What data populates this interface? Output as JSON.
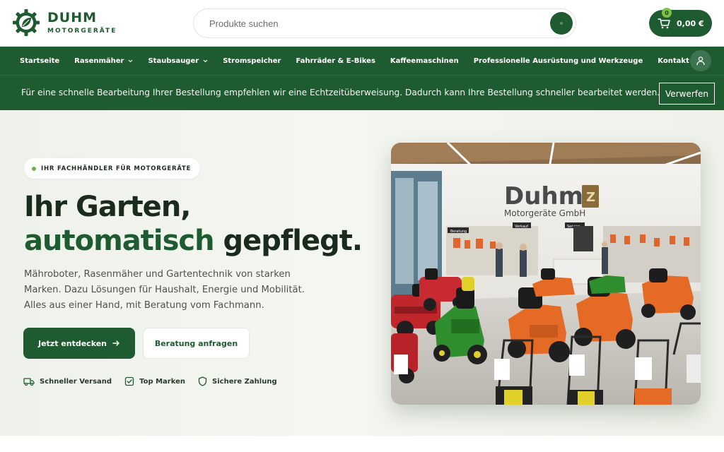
{
  "brand": {
    "name": "DUHM",
    "tagline": "MOTORGERÄTE",
    "logo_icon": "gear-leaf-icon",
    "color_primary": "#1f5b30",
    "color_accent": "#6db144"
  },
  "search": {
    "placeholder": "Produkte suchen",
    "icon": "search-icon"
  },
  "cart": {
    "count": "0",
    "total": "0,00 €",
    "icon": "cart-icon"
  },
  "nav": {
    "items": [
      {
        "label": "Startseite",
        "dropdown": false
      },
      {
        "label": "Rasenmäher",
        "dropdown": true
      },
      {
        "label": "Staubsauger",
        "dropdown": true
      },
      {
        "label": "Stromspeicher",
        "dropdown": false
      },
      {
        "label": "Fahrräder & E-Bikes",
        "dropdown": false
      },
      {
        "label": "Kaffeemaschinen",
        "dropdown": false
      },
      {
        "label": "Professionelle Ausrüstung und Werkzeuge",
        "dropdown": false
      },
      {
        "label": "Kontakt",
        "dropdown": false
      }
    ],
    "account_icon": "user-icon"
  },
  "notice": {
    "text": "Für eine schnelle Bearbeitung Ihrer Bestellung empfehlen wir eine Echtzeitüberweisung. Dadurch kann Ihre Bestellung schneller bearbeitet werden.",
    "dismiss_label": "Verwerfen"
  },
  "hero": {
    "eyebrow": "IHR FACHHÄNDLER FÜR MOTORGERÄTE",
    "headline_line1": "Ihr Garten,",
    "headline_accent": "automatisch",
    "headline_rest": " gepflegt.",
    "lead": "Mähroboter, Rasenmäher und Gartentechnik von starken Marken. Dazu Lösungen für Haushalt, Energie und Mobilität. Alles aus einer Hand, mit Beratung vom Fachmann.",
    "cta_primary": "Jetzt entdecken",
    "cta_secondary": "Beratung anfragen",
    "features": [
      {
        "label": "Schneller Versand",
        "icon": "truck-icon"
      },
      {
        "label": "Top Marken",
        "icon": "check-square-icon"
      },
      {
        "label": "Sichere Zahlung",
        "icon": "shield-icon"
      }
    ],
    "photo": {
      "sign_name": "Duhm",
      "sign_sub": "Motorgeräte GmbH",
      "sign_icon": "Z",
      "shelf_labels": [
        "Beratung",
        "Service",
        "Verkauf"
      ]
    }
  }
}
